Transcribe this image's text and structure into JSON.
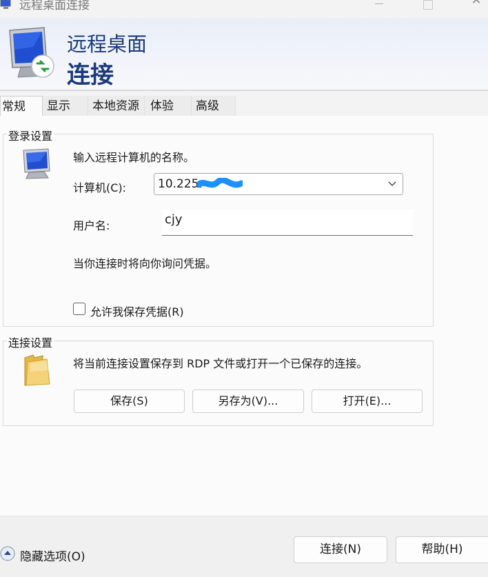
{
  "window": {
    "title": "远程桌面连接",
    "minimize_label": "—",
    "close_label": "✕"
  },
  "banner": {
    "line1": "远程桌面",
    "line2": "连接"
  },
  "tabs": [
    {
      "label": "常规",
      "active": true
    },
    {
      "label": "显示"
    },
    {
      "label": "本地资源"
    },
    {
      "label": "体验"
    },
    {
      "label": "高级"
    }
  ],
  "login": {
    "group_label": "登录设置",
    "prompt": "输入远程计算机的名称。",
    "computer_label": "计算机(C):",
    "computer_value": "10.225.",
    "username_label": "用户名:",
    "username_value": "cjy",
    "credential_note": "当你连接时将向你询问凭据。",
    "save_credentials_label": "允许我保存凭据(R)",
    "save_credentials_checked": false
  },
  "connection": {
    "group_label": "连接设置",
    "description": "将当前连接设置保存到 RDP 文件或打开一个已保存的连接。",
    "save_label": "保存(S)",
    "save_as_label": "另存为(V)...",
    "open_label": "打开(E)..."
  },
  "footer": {
    "hide_options_label": "隐藏选项(O)",
    "connect_label": "连接(N)",
    "help_label": "帮助(H)"
  },
  "colors": {
    "banner_text": "#1a3a7a",
    "redaction": "#1e90ff"
  }
}
